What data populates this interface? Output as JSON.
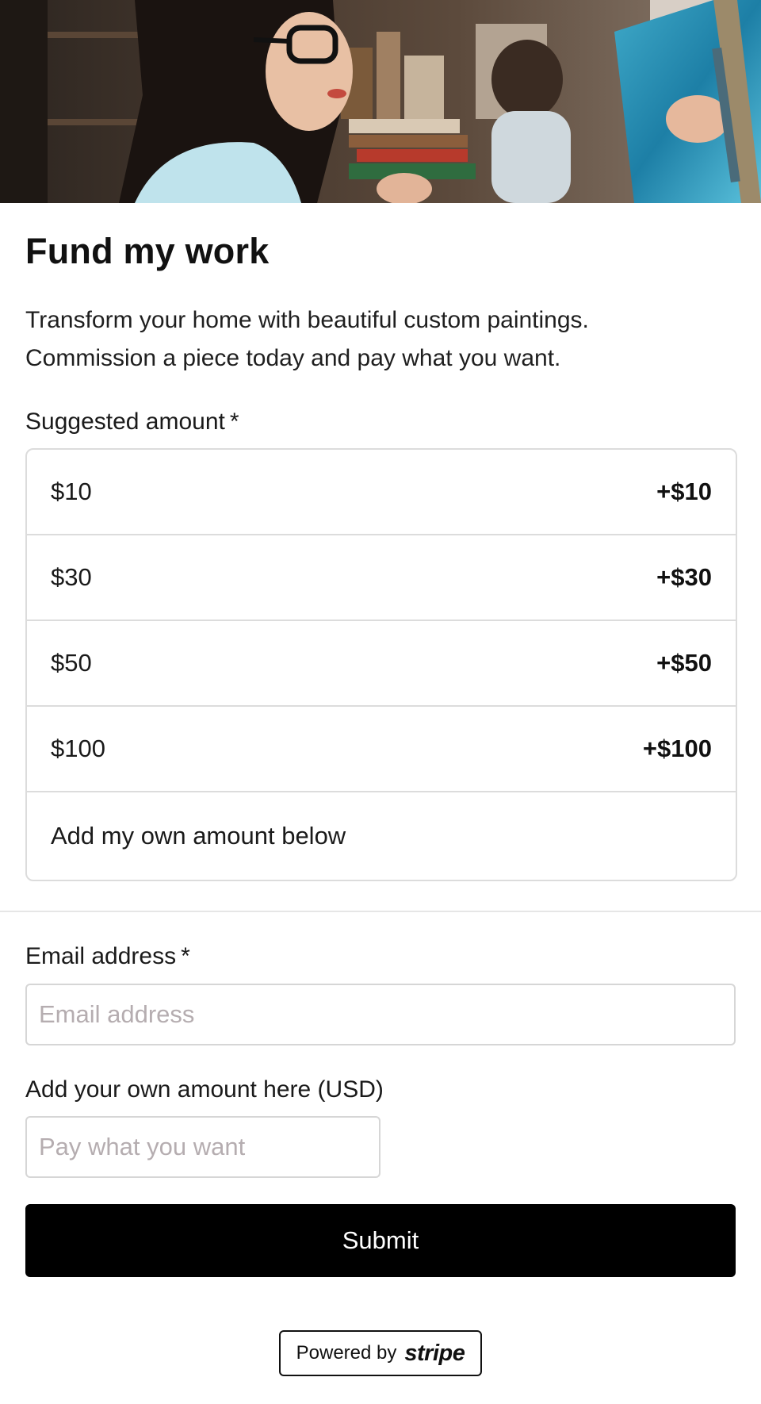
{
  "page": {
    "title": "Fund my work",
    "description_line1": "Transform your home with beautiful custom paintings.",
    "description_line2": "Commission a piece today and pay what you want."
  },
  "suggested": {
    "label": "Suggested amount",
    "required_mark": "*",
    "options": [
      {
        "label": "$10",
        "price": "+$10"
      },
      {
        "label": "$30",
        "price": "+$30"
      },
      {
        "label": "$50",
        "price": "+$50"
      },
      {
        "label": "$100",
        "price": "+$100"
      },
      {
        "label": "Add my own amount below",
        "price": ""
      }
    ]
  },
  "email": {
    "label": "Email address",
    "required_mark": "*",
    "placeholder": "Email address",
    "value": ""
  },
  "custom_amount": {
    "label": "Add your own amount here (USD)",
    "placeholder": "Pay what you want",
    "value": ""
  },
  "submit": {
    "label": "Submit"
  },
  "footer": {
    "powered_by": "Powered by",
    "brand": "stripe"
  },
  "colors": {
    "button_bg": "#000000",
    "button_text": "#ffffff",
    "border": "#dcdcdc",
    "placeholder": "#b5adb0"
  }
}
